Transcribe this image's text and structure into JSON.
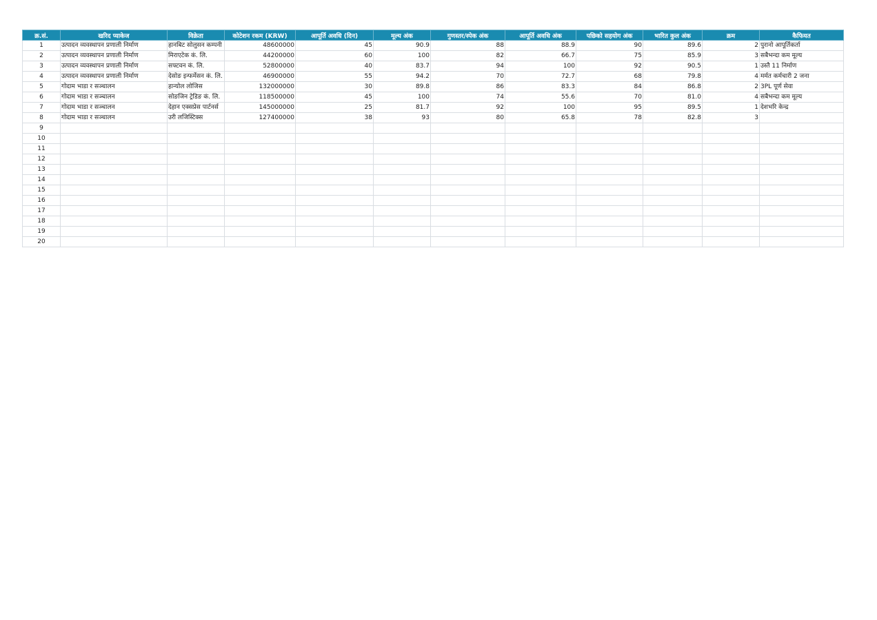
{
  "headers": [
    "क्र.सं.",
    "खरिद प्याकेज",
    "विक्रेता",
    "कोटेशन रकम (KRW)",
    "आपूर्ति अवधि (दिन)",
    "मूल्य अंक",
    "गुणस्तर/स्पेक अंक",
    "आपूर्ति अवधि अंक",
    "पछिको सहयोग अंक",
    "भारित कुल अंक",
    "क्रम",
    "कैफियत"
  ],
  "rows": [
    [
      "1",
      "उत्पादन व्यवस्थापन प्रणाली निर्माण",
      "हानबिट सोलुसन कम्पनी",
      "48600000",
      "45",
      "90.9",
      "88",
      "88.9",
      "90",
      "89.6",
      "2",
      "पुरानो आपूर्तिकर्ता"
    ],
    [
      "2",
      "उत्पादन व्यवस्थापन प्रणाली निर्माण",
      "मिराएटेक कं. लि.",
      "44200000",
      "60",
      "100",
      "82",
      "66.7",
      "75",
      "85.9",
      "3",
      "सबैभन्दा कम मूल्य"
    ],
    [
      "3",
      "उत्पादन व्यवस्थापन प्रणाली निर्माण",
      "सफ्टवन कं. लि.",
      "52800000",
      "40",
      "83.7",
      "94",
      "100",
      "92",
      "90.5",
      "1",
      "उस्तै 11 निर्माण"
    ],
    [
      "4",
      "उत्पादन व्यवस्थापन प्रणाली निर्माण",
      "देसोङ इन्फर्मेसन कं. लि.",
      "46900000",
      "55",
      "94.2",
      "70",
      "72.7",
      "68",
      "79.8",
      "4",
      "मर्मत कर्मचारी 2 जना"
    ],
    [
      "5",
      "गोदाम भाडा र सञ्चालन",
      "हान्योल लोजिस",
      "132000000",
      "30",
      "89.8",
      "86",
      "83.3",
      "84",
      "86.8",
      "2",
      "3PL पूर्ण सेवा"
    ],
    [
      "6",
      "गोदाम भाडा र सञ्चालन",
      "सोङजिन ट्रेडिङ कं. लि.",
      "118500000",
      "45",
      "100",
      "74",
      "55.6",
      "70",
      "81.0",
      "4",
      "सबैभन्दा कम मूल्य"
    ],
    [
      "7",
      "गोदाम भाडा र सञ्चालन",
      "देहान एक्सप्रेस पार्टनर्स",
      "145000000",
      "25",
      "81.7",
      "92",
      "100",
      "95",
      "89.5",
      "1",
      "देशभरि केन्द्र"
    ],
    [
      "8",
      "गोदाम भाडा र सञ्चालन",
      "उरी लजिस्टिक्स",
      "127400000",
      "38",
      "93",
      "80",
      "65.8",
      "78",
      "82.8",
      "3",
      ""
    ],
    [
      "9",
      "",
      "",
      "",
      "",
      "",
      "",
      "",
      "",
      "",
      "",
      ""
    ],
    [
      "10",
      "",
      "",
      "",
      "",
      "",
      "",
      "",
      "",
      "",
      "",
      ""
    ],
    [
      "11",
      "",
      "",
      "",
      "",
      "",
      "",
      "",
      "",
      "",
      "",
      ""
    ],
    [
      "12",
      "",
      "",
      "",
      "",
      "",
      "",
      "",
      "",
      "",
      "",
      ""
    ],
    [
      "13",
      "",
      "",
      "",
      "",
      "",
      "",
      "",
      "",
      "",
      "",
      ""
    ],
    [
      "14",
      "",
      "",
      "",
      "",
      "",
      "",
      "",
      "",
      "",
      "",
      ""
    ],
    [
      "15",
      "",
      "",
      "",
      "",
      "",
      "",
      "",
      "",
      "",
      "",
      ""
    ],
    [
      "16",
      "",
      "",
      "",
      "",
      "",
      "",
      "",
      "",
      "",
      "",
      ""
    ],
    [
      "17",
      "",
      "",
      "",
      "",
      "",
      "",
      "",
      "",
      "",
      "",
      ""
    ],
    [
      "18",
      "",
      "",
      "",
      "",
      "",
      "",
      "",
      "",
      "",
      "",
      ""
    ],
    [
      "19",
      "",
      "",
      "",
      "",
      "",
      "",
      "",
      "",
      "",
      "",
      ""
    ],
    [
      "20",
      "",
      "",
      "",
      "",
      "",
      "",
      "",
      "",
      "",
      "",
      ""
    ]
  ],
  "colors": {
    "header_bg": "#1a8bb0",
    "header_text": "#ffffff",
    "grid": "#d9dde2"
  }
}
